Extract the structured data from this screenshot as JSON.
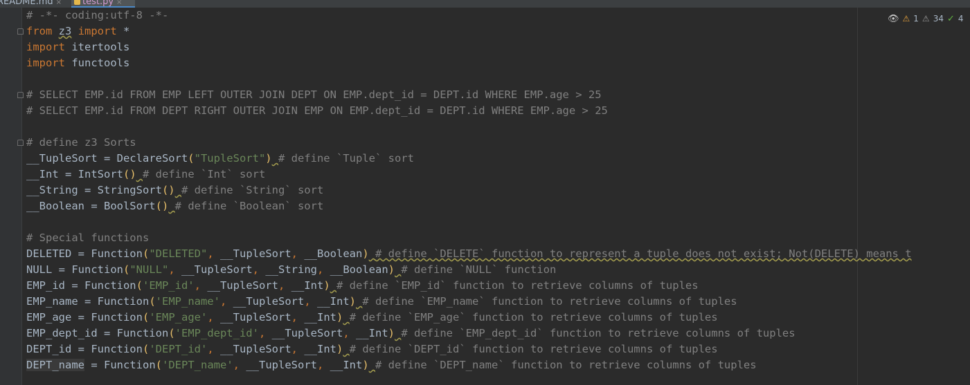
{
  "tabs": [
    {
      "label": "README.md",
      "active": false
    },
    {
      "label": "test.py",
      "active": true
    }
  ],
  "inspections": {
    "warnings": "1",
    "weak_warnings": "34",
    "typos": "4"
  },
  "colors": {
    "background": "#2b2b2b",
    "keyword": "#cc7832",
    "comment": "#808080",
    "string": "#6a8759",
    "paren": "#e8bf6a",
    "text": "#a9b7c6"
  },
  "code": {
    "lines": [
      [
        {
          "t": "cm",
          "s": "# -*- coding:utf-8 -*-"
        }
      ],
      [
        {
          "t": "kw",
          "s": "from"
        },
        {
          "t": "",
          "s": " "
        },
        {
          "t": "sq",
          "s": "z3"
        },
        {
          "t": "",
          "s": " "
        },
        {
          "t": "kw",
          "s": "import"
        },
        {
          "t": "",
          "s": " *"
        }
      ],
      [
        {
          "t": "kw",
          "s": "import"
        },
        {
          "t": "",
          "s": " itertools"
        }
      ],
      [
        {
          "t": "kw",
          "s": "import"
        },
        {
          "t": "",
          "s": " functools"
        }
      ],
      [],
      [
        {
          "t": "cm",
          "s": "# SELECT EMP.id FROM EMP LEFT OUTER JOIN DEPT ON EMP.dept_id = DEPT.id WHERE EMP.age > 25"
        }
      ],
      [
        {
          "t": "cm",
          "s": "# SELECT EMP.id FROM DEPT RIGHT OUTER JOIN EMP ON EMP.dept_id = DEPT.id WHERE EMP.age > 25"
        }
      ],
      [],
      [
        {
          "t": "cm",
          "s": "# define z3 Sorts"
        }
      ],
      [
        {
          "t": "",
          "s": "__TupleSort = DeclareSort"
        },
        {
          "t": "pn",
          "s": "("
        },
        {
          "t": "st",
          "s": "\"TupleSort\""
        },
        {
          "t": "pn",
          "s": ")"
        },
        {
          "t": "sq",
          "s": " "
        },
        {
          "t": "cm",
          "s": "# define `Tuple` sort"
        }
      ],
      [
        {
          "t": "",
          "s": "__Int = IntSort"
        },
        {
          "t": "pn",
          "s": "()"
        },
        {
          "t": "sq",
          "s": " "
        },
        {
          "t": "cm",
          "s": "# define `Int` sort"
        }
      ],
      [
        {
          "t": "",
          "s": "__String = StringSort"
        },
        {
          "t": "pn",
          "s": "()"
        },
        {
          "t": "sq",
          "s": " "
        },
        {
          "t": "cm",
          "s": "# define `String` sort"
        }
      ],
      [
        {
          "t": "",
          "s": "__Boolean = BoolSort"
        },
        {
          "t": "pn",
          "s": "()"
        },
        {
          "t": "sq",
          "s": " "
        },
        {
          "t": "cm",
          "s": "# define `Boolean` sort"
        }
      ],
      [],
      [
        {
          "t": "cm",
          "s": "# Special functions"
        }
      ],
      [
        {
          "t": "",
          "s": "DELETED = Function"
        },
        {
          "t": "pn",
          "s": "("
        },
        {
          "t": "st",
          "s": "\"DELETED\""
        },
        {
          "t": "kw",
          "s": ","
        },
        {
          "t": "",
          "s": " __TupleSort"
        },
        {
          "t": "kw",
          "s": ","
        },
        {
          "t": "",
          "s": " __Boolean"
        },
        {
          "t": "pn",
          "s": ")"
        },
        {
          "t": "sq",
          "s": " "
        },
        {
          "t": "cmsq",
          "s": "# define `DELETE` function to represent a tuple does not exist; Not(DELETE) means t"
        }
      ],
      [
        {
          "t": "",
          "s": "NULL = Function"
        },
        {
          "t": "pn",
          "s": "("
        },
        {
          "t": "st",
          "s": "\"NULL\""
        },
        {
          "t": "kw",
          "s": ","
        },
        {
          "t": "",
          "s": " __TupleSort"
        },
        {
          "t": "kw",
          "s": ","
        },
        {
          "t": "",
          "s": " __String"
        },
        {
          "t": "kw",
          "s": ","
        },
        {
          "t": "",
          "s": " __Boolean"
        },
        {
          "t": "pn",
          "s": ")"
        },
        {
          "t": "sq",
          "s": " "
        },
        {
          "t": "cm",
          "s": "# define `NULL` function"
        }
      ],
      [
        {
          "t": "",
          "s": "EMP_id = Function"
        },
        {
          "t": "pn",
          "s": "("
        },
        {
          "t": "st",
          "s": "'EMP_id'"
        },
        {
          "t": "kw",
          "s": ","
        },
        {
          "t": "",
          "s": " __TupleSort"
        },
        {
          "t": "kw",
          "s": ","
        },
        {
          "t": "",
          "s": " __Int"
        },
        {
          "t": "pn",
          "s": ")"
        },
        {
          "t": "sq",
          "s": " "
        },
        {
          "t": "cm",
          "s": "# define `EMP_id` function to retrieve columns of tuples"
        }
      ],
      [
        {
          "t": "",
          "s": "EMP_name = Function"
        },
        {
          "t": "pn",
          "s": "("
        },
        {
          "t": "st",
          "s": "'EMP_name'"
        },
        {
          "t": "kw",
          "s": ","
        },
        {
          "t": "",
          "s": " __TupleSort"
        },
        {
          "t": "kw",
          "s": ","
        },
        {
          "t": "",
          "s": " __Int"
        },
        {
          "t": "pn",
          "s": ")"
        },
        {
          "t": "sq",
          "s": " "
        },
        {
          "t": "cm",
          "s": "# define `EMP_name` function to retrieve columns of tuples"
        }
      ],
      [
        {
          "t": "",
          "s": "EMP_age = Function"
        },
        {
          "t": "pn",
          "s": "("
        },
        {
          "t": "st",
          "s": "'EMP_age'"
        },
        {
          "t": "kw",
          "s": ","
        },
        {
          "t": "",
          "s": " __TupleSort"
        },
        {
          "t": "kw",
          "s": ","
        },
        {
          "t": "",
          "s": " __Int"
        },
        {
          "t": "pn",
          "s": ")"
        },
        {
          "t": "sq",
          "s": " "
        },
        {
          "t": "cm",
          "s": "# define `EMP_age` function to retrieve columns of tuples"
        }
      ],
      [
        {
          "t": "",
          "s": "EMP_dept_id = Function"
        },
        {
          "t": "pn",
          "s": "("
        },
        {
          "t": "st",
          "s": "'EMP_dept_id'"
        },
        {
          "t": "kw",
          "s": ","
        },
        {
          "t": "",
          "s": " __TupleSort"
        },
        {
          "t": "kw",
          "s": ","
        },
        {
          "t": "",
          "s": " __Int"
        },
        {
          "t": "pn",
          "s": ")"
        },
        {
          "t": "sq",
          "s": " "
        },
        {
          "t": "cm",
          "s": "# define `EMP_dept_id` function to retrieve columns of tuples"
        }
      ],
      [
        {
          "t": "",
          "s": "DEPT_id = Function"
        },
        {
          "t": "pn",
          "s": "("
        },
        {
          "t": "st",
          "s": "'DEPT_id'"
        },
        {
          "t": "kw",
          "s": ","
        },
        {
          "t": "",
          "s": " __TupleSort"
        },
        {
          "t": "kw",
          "s": ","
        },
        {
          "t": "",
          "s": " __Int"
        },
        {
          "t": "pn",
          "s": ")"
        },
        {
          "t": "sq",
          "s": " "
        },
        {
          "t": "cm",
          "s": "# define `DEPT_id` function to retrieve columns of tuples"
        }
      ],
      [
        {
          "t": "sel",
          "s": "DEPT_name"
        },
        {
          "t": "",
          "s": " = Function"
        },
        {
          "t": "pn",
          "s": "("
        },
        {
          "t": "st",
          "s": "'DEPT_name'"
        },
        {
          "t": "kw",
          "s": ","
        },
        {
          "t": "",
          "s": " __TupleSort"
        },
        {
          "t": "kw",
          "s": ","
        },
        {
          "t": "",
          "s": " __Int"
        },
        {
          "t": "pn",
          "s": ")"
        },
        {
          "t": "sq",
          "s": " "
        },
        {
          "t": "cm",
          "s": "# define `DEPT_name` function to retrieve columns of tuples"
        }
      ]
    ]
  }
}
